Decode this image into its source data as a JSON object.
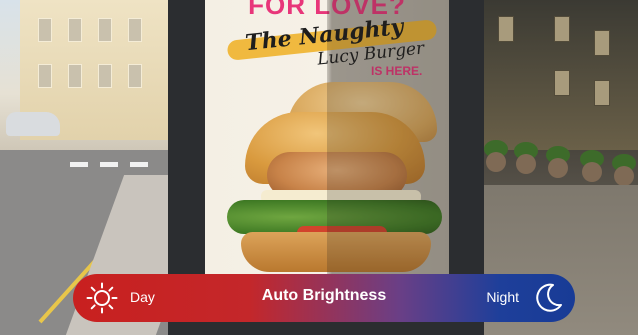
{
  "poster": {
    "headline_top": "FOR LOVE?",
    "headline_line1": "The Naughty",
    "headline_line2": "Lucy Burger",
    "headline_line3": "IS HERE."
  },
  "bar": {
    "left_label": "Day",
    "title": "Auto Brightness",
    "right_label": "Night",
    "left_icon": "sun-icon",
    "right_icon": "moon-icon",
    "gradient_start": "#c8201f",
    "gradient_end": "#183b96"
  },
  "colors": {
    "poster_pink": "#e8367a",
    "poster_brush": "#f0b32c",
    "bar_text": "#ffffff"
  }
}
